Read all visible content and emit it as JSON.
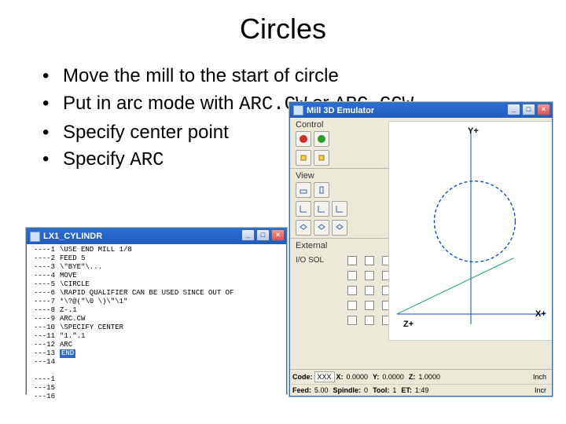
{
  "title": "Circles",
  "bullets": {
    "b1": "Move the mill to the start of circle",
    "b2a": "Put in arc mode with ",
    "b2_code1": "ARC.CW",
    "b2_or": " or ",
    "b2_code2": "ARC.CCW",
    "b3": "Specify center point",
    "b4a": "Specify ",
    "b4_code": "ARC"
  },
  "code_win": {
    "title": "LX1_CYLINDR",
    "linenums": [
      "----1",
      "----2",
      "----3",
      "----4",
      "----5",
      "----6",
      "----7",
      "----8",
      "----9",
      "---10",
      "---11",
      "---12",
      "---13",
      "---14",
      "",
      "----1",
      "---15",
      "---16"
    ],
    "lines": [
      "\\USE END MILL 1/8",
      "FEED 5",
      "\\\"BYE\"\\...",
      "MOVE",
      "\\CIRCLE",
      "\\RAPID QUALIFIER CAN BE USED SINCE OUT OF",
      "*\\?@(\"\\0 \\)\\\"\\1\"",
      "Z-.1",
      "ARC.CW",
      "\\SPECIFY CENTER",
      "\"1.\".1",
      "ARC",
      "END",
      "",
      "",
      "",
      "",
      ""
    ],
    "cursor_line_index": 12
  },
  "emu_win": {
    "title": "Mill 3D Emulator",
    "section_control": "Control",
    "section_view": "View",
    "section_external": "External",
    "ext_rows": [
      "I/O SOL",
      "",
      "",
      "",
      ""
    ],
    "axis": {
      "yplus": "Y+",
      "zplus": "Z+",
      "xplus": "X+"
    },
    "status": {
      "row1": {
        "code_lbl": "Code:",
        "code_val": "XXX",
        "x_lbl": "X:",
        "x_val": "0.0000",
        "y_lbl": "Y:",
        "y_val": "0.0000",
        "z_lbl": "Z:",
        "z_val": "1.0000",
        "unit": "Inch"
      },
      "row2": {
        "feed_lbl": "Feed:",
        "feed_val": "5.00",
        "spindle_lbl": "Spindle:",
        "spindle_val": "0",
        "tool_lbl": "Tool:",
        "tool_val": "1",
        "et_lbl": "ET:",
        "et_val": "1:49",
        "unit": "Incr"
      }
    }
  }
}
